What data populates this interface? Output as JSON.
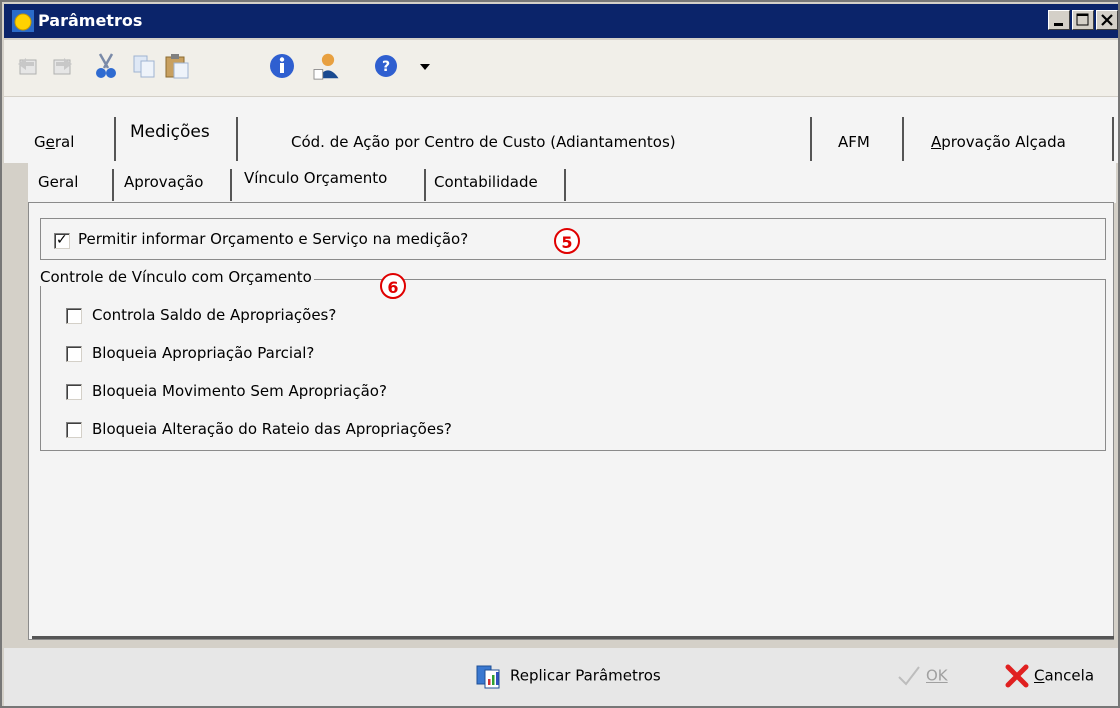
{
  "window": {
    "title": "Parâmetros"
  },
  "toolbar": {
    "items": [
      "undo-icon",
      "redo-icon",
      "cut-icon",
      "copy-icon",
      "paste-icon",
      "info-icon",
      "user-icon",
      "help-icon"
    ]
  },
  "main_tabs": [
    {
      "label": "Geral",
      "hotkey": "e"
    },
    {
      "label": "Medições"
    },
    {
      "label": "Cód. de Ação por Centro de Custo (Adiantamentos)"
    },
    {
      "label": "AFM"
    },
    {
      "label": "Aprovação Alçada",
      "hotkey": "A"
    }
  ],
  "sub_tabs": [
    {
      "label": "Geral"
    },
    {
      "label": "Aprovação"
    },
    {
      "label": "Vínculo Orçamento"
    },
    {
      "label": "Contabilidade"
    }
  ],
  "allow_option": {
    "label": "Permitir informar Orçamento e Serviço na medição?",
    "checked": true,
    "badge": "5"
  },
  "group": {
    "title": "Controle de Vínculo com Orçamento",
    "badge": "6",
    "options": [
      {
        "label": "Controla Saldo de Apropriações?",
        "checked": false
      },
      {
        "label": "Bloqueia Apropriação Parcial?",
        "checked": false
      },
      {
        "label": "Bloqueia Movimento Sem Apropriação?",
        "checked": false
      },
      {
        "label": "Bloqueia Alteração do Rateio das Apropriações?",
        "checked": false
      }
    ]
  },
  "footer": {
    "replicate": "Replicar Parâmetros",
    "ok": "OK",
    "cancel": "Cancela"
  },
  "colors": {
    "titlebar": "#0b246a",
    "badge": "#e00000"
  }
}
